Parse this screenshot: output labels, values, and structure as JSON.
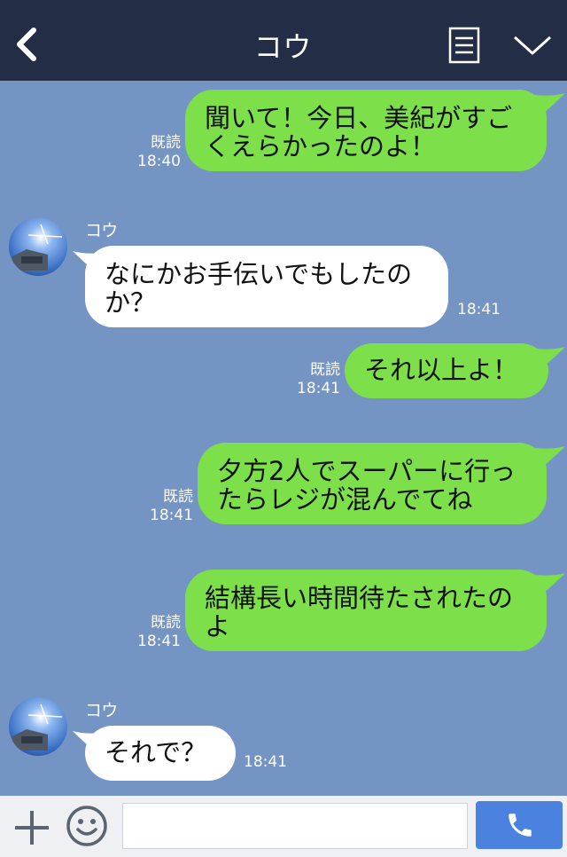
{
  "header": {
    "title": "コウ"
  },
  "messages": [
    {
      "side": "me",
      "lines": [
        "聞いて！今日、美紀がすご",
        "くえらかったのよ！"
      ],
      "read": "既読",
      "time": "18:40"
    },
    {
      "side": "them",
      "sender": "コウ",
      "lines": [
        "なにかお手伝いでもしたの",
        "か？"
      ],
      "time": "18:41"
    },
    {
      "side": "me",
      "lines": [
        "それ以上よ！"
      ],
      "read": "既読",
      "time": "18:41"
    },
    {
      "side": "me",
      "lines": [
        "夕方2人でスーパーに行っ",
        "たらレジが混んでてね"
      ],
      "read": "既読",
      "time": "18:41"
    },
    {
      "side": "me",
      "lines": [
        "結構長い時間待たされたの",
        "よ"
      ],
      "read": "既読",
      "time": "18:41"
    },
    {
      "side": "them",
      "sender": "コウ",
      "lines": [
        "それで？"
      ],
      "time": "18:41"
    }
  ],
  "input": {
    "placeholder": ""
  },
  "colors": {
    "header": "#232e46",
    "background": "#7494c4",
    "my_bubble": "#7de04b",
    "their_bubble": "#ffffff",
    "call_button": "#4b82df"
  },
  "icons": [
    "back-arrow-icon",
    "note-icon",
    "chevron-down-icon",
    "plus-icon",
    "smiley-icon",
    "phone-icon"
  ]
}
